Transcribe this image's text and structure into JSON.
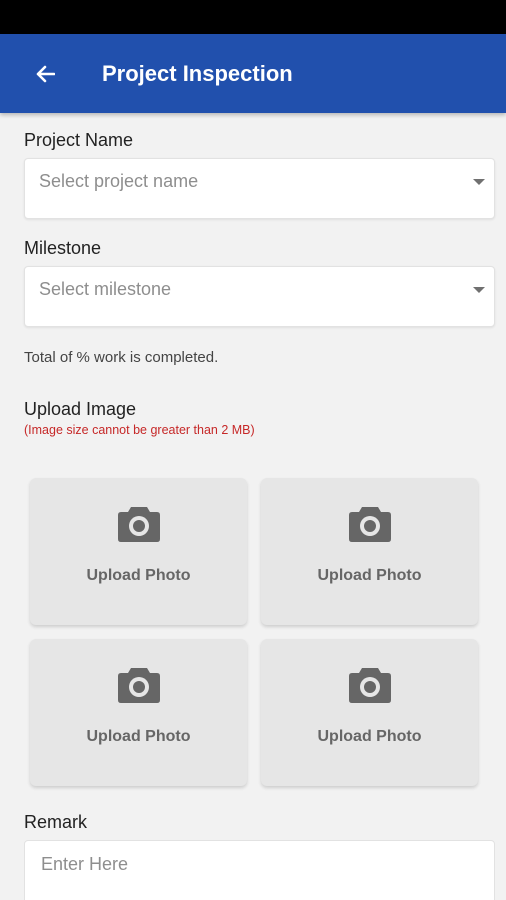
{
  "app_bar": {
    "title": "Project Inspection",
    "back_icon": "arrow-left-icon"
  },
  "form": {
    "project_name": {
      "label": "Project Name",
      "placeholder": "Select project name"
    },
    "milestone": {
      "label": "Milestone",
      "placeholder": "Select milestone"
    },
    "completion_note": "Total of % work is completed.",
    "upload": {
      "label": "Upload Image",
      "warning": "(Image size cannot be greater than 2 MB)",
      "tiles": [
        {
          "text": "Upload Photo",
          "icon": "camera-icon"
        },
        {
          "text": "Upload Photo",
          "icon": "camera-icon"
        },
        {
          "text": "Upload Photo",
          "icon": "camera-icon"
        },
        {
          "text": "Upload Photo",
          "icon": "camera-icon"
        }
      ]
    },
    "remark": {
      "label": "Remark",
      "placeholder": "Enter Here"
    }
  },
  "colors": {
    "app_bar": "#2150ad",
    "warning": "#c62828",
    "background": "#f2f2f2"
  }
}
